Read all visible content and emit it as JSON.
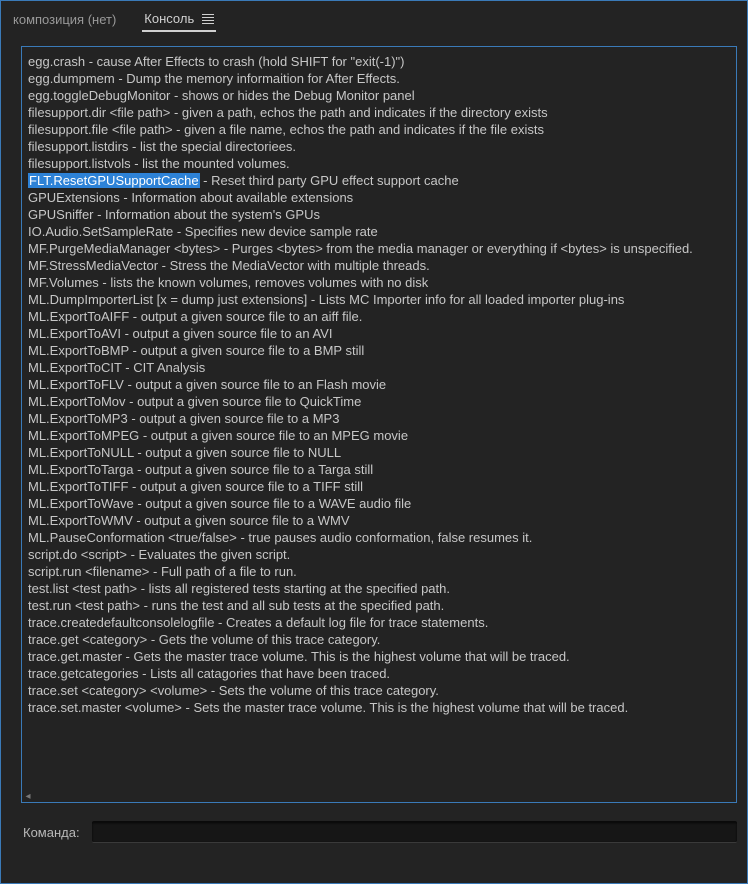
{
  "tabs": {
    "composition": "композиция (нет)",
    "console": "Консоль"
  },
  "console_lines": [
    {
      "text": "egg.crash - cause After Effects to crash (hold SHIFT for \"exit(-1)\")"
    },
    {
      "text": "egg.dumpmem - Dump the memory informaition for After Effects."
    },
    {
      "text": "egg.toggleDebugMonitor - shows or hides the Debug Monitor panel"
    },
    {
      "text": "filesupport.dir <file path> - given a path, echos the path and indicates if the directory exists"
    },
    {
      "text": "filesupport.file <file path> - given a file name, echos the path and indicates if the file exists"
    },
    {
      "text": "filesupport.listdirs - list the special directoriees."
    },
    {
      "text": "filesupport.listvols - list the mounted volumes."
    },
    {
      "highlight": "FLT.ResetGPUSupportCache",
      "text": " - Reset third party GPU effect support cache"
    },
    {
      "text": "GPUExtensions - Information about available extensions"
    },
    {
      "text": "GPUSniffer - Information about the system's GPUs"
    },
    {
      "text": "IO.Audio.SetSampleRate - Specifies new device sample rate"
    },
    {
      "text": "MF.PurgeMediaManager <bytes> - Purges <bytes> from the media manager or everything if <bytes> is unspecified."
    },
    {
      "text": "MF.StressMediaVector - Stress the MediaVector with multiple threads."
    },
    {
      "text": "MF.Volumes - lists the known volumes, removes volumes with no disk"
    },
    {
      "text": "ML.DumpImporterList [x = dump just extensions]  - Lists MC Importer info for all loaded importer plug-ins"
    },
    {
      "text": "ML.ExportToAIFF - output a given source file to an aiff file."
    },
    {
      "text": "ML.ExportToAVI - output a given source file to an AVI"
    },
    {
      "text": "ML.ExportToBMP - output a given source file to a BMP still"
    },
    {
      "text": "ML.ExportToCIT - CIT Analysis"
    },
    {
      "text": "ML.ExportToFLV - output a given source file to an Flash movie"
    },
    {
      "text": "ML.ExportToMov - output a given source file to QuickTime"
    },
    {
      "text": "ML.ExportToMP3 - output a given source file to a MP3"
    },
    {
      "text": "ML.ExportToMPEG - output a given source file to an MPEG movie"
    },
    {
      "text": "ML.ExportToNULL - output a given source file to NULL"
    },
    {
      "text": "ML.ExportToTarga - output a given source file to a Targa still"
    },
    {
      "text": "ML.ExportToTIFF - output a given source file to a TIFF still"
    },
    {
      "text": "ML.ExportToWave - output a given source file to a WAVE audio file"
    },
    {
      "text": "ML.ExportToWMV - output a given source file to a WMV"
    },
    {
      "text": "ML.PauseConformation <true/false> - true pauses audio conformation, false resumes it."
    },
    {
      "text": "script.do <script> - Evaluates the given script."
    },
    {
      "text": "script.run <filename> - Full path of a file to run."
    },
    {
      "text": "test.list <test path> - lists all registered tests starting at the specified path."
    },
    {
      "text": "test.run <test path> - runs the test and all sub tests at the specified path."
    },
    {
      "text": "trace.createdefaultconsolelogfile - Creates a default log file for trace statements."
    },
    {
      "text": "trace.get <category> - Gets the volume of this trace category."
    },
    {
      "text": "trace.get.master - Gets the master trace volume. This is the highest volume that will be traced."
    },
    {
      "text": "trace.getcategories - Lists all catagories that have been traced."
    },
    {
      "text": "trace.set <category> <volume> - Sets the volume of this trace category."
    },
    {
      "text": "trace.set.master <volume> - Sets the master trace volume. This is the highest volume that will be traced."
    }
  ],
  "command": {
    "label": "Команда:",
    "value": ""
  },
  "scroll_arrow": "◂"
}
